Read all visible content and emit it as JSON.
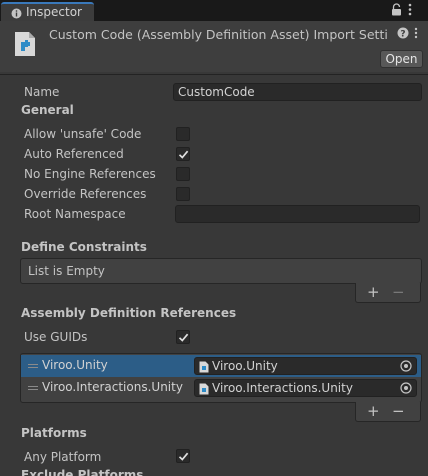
{
  "tab": {
    "label": "Inspector"
  },
  "header": {
    "title": "Custom Code (Assembly Definition Asset) Import Setti",
    "open_label": "Open"
  },
  "fields": {
    "name_label": "Name",
    "name_value": "CustomCode",
    "general_label": "General",
    "allow_unsafe_label": "Allow 'unsafe' Code",
    "allow_unsafe_checked": false,
    "auto_referenced_label": "Auto Referenced",
    "auto_referenced_checked": true,
    "no_engine_refs_label": "No Engine References",
    "no_engine_refs_checked": false,
    "override_refs_label": "Override References",
    "override_refs_checked": false,
    "root_namespace_label": "Root Namespace",
    "root_namespace_value": ""
  },
  "define_constraints": {
    "label": "Define Constraints",
    "empty_text": "List is Empty"
  },
  "assembly_refs": {
    "label": "Assembly Definition References",
    "use_guids_label": "Use GUIDs",
    "use_guids_checked": true,
    "items": [
      {
        "name": "Viroo.Unity",
        "value": "Viroo.Unity",
        "selected": true
      },
      {
        "name": "Viroo.Interactions.Unity",
        "value": "Viroo.Interactions.Unity",
        "selected": false
      }
    ]
  },
  "platforms": {
    "label": "Platforms",
    "any_platform_label": "Any Platform",
    "any_platform_checked": true,
    "exclude_label": "Exclude Platforms"
  },
  "list_controls": {
    "add": "+",
    "remove": "−"
  },
  "colors": {
    "selection": "#2c5d87",
    "tab_accent": "#3a79bb",
    "background": "#383838"
  }
}
